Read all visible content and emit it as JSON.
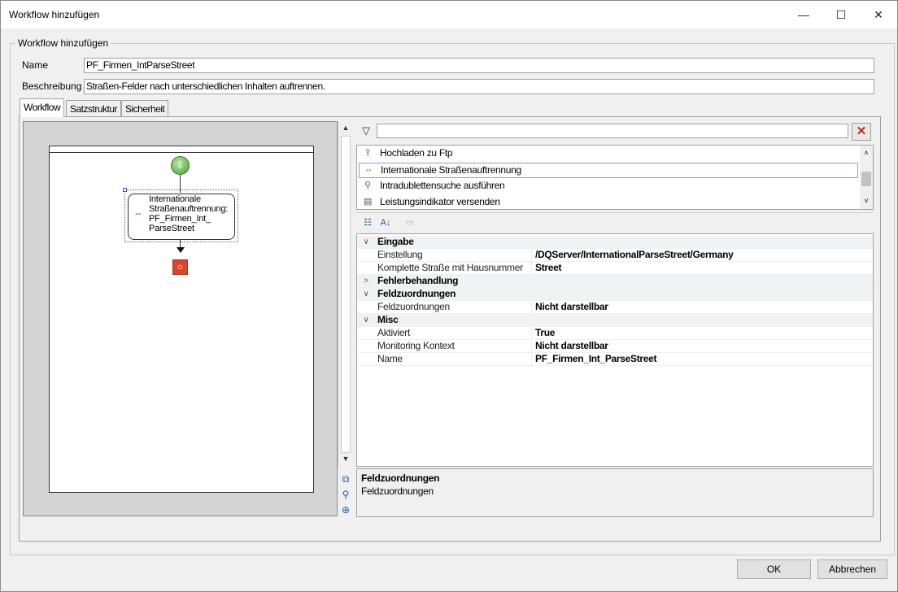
{
  "window": {
    "title": "Workflow hinzufügen",
    "controls": {
      "minimize": "—",
      "maximize": "☐",
      "close": "✕"
    }
  },
  "groupbox": {
    "title": "Workflow hinzufügen"
  },
  "form": {
    "name_label": "Name",
    "name_value": "PF_Firmen_IntParseStreet",
    "description_label": "Beschreibung",
    "description_value": "Straßen-Felder nach unterschiedlichen Inhalten auftrennen."
  },
  "tabs": [
    {
      "label": "Workflow",
      "active": true
    },
    {
      "label": "Satzstruktur",
      "active": false
    },
    {
      "label": "Sicherheit",
      "active": false
    }
  ],
  "designer": {
    "start_icon": "green-down-arrow-circle",
    "node": {
      "line1": "Internationale",
      "line2": "Straßenauftrennung:",
      "line3": "PF_Firmen_Int_",
      "line4": "ParseStreet"
    },
    "end_icon": "red-stop-square"
  },
  "side_tools": [
    "copy-icon",
    "find-icon",
    "zoom-icon"
  ],
  "activity_filter": {
    "value": ""
  },
  "activities": [
    {
      "label": "Hochladen zu Ftp",
      "icon": "upload-icon",
      "selected": false
    },
    {
      "label": "Internationale Straßenauftrennung",
      "icon": "split-arrows-icon",
      "selected": true
    },
    {
      "label": "Intradublettensuche ausführen",
      "icon": "magnifier-icon",
      "selected": false
    },
    {
      "label": "Leistungsindikator versenden",
      "icon": "indicator-icon",
      "selected": false
    }
  ],
  "propgrid": {
    "toolbar": [
      "categorized-icon",
      "alphabetical-icon",
      "property-pages-icon"
    ],
    "rows": [
      {
        "kind": "cat",
        "expander": "∨",
        "name": "Eingabe"
      },
      {
        "kind": "prop",
        "name": "Einstellung",
        "value": "/DQServer/InternationalParseStreet/Germany"
      },
      {
        "kind": "prop",
        "name": "Komplette Straße mit Hausnummer",
        "value": "Street"
      },
      {
        "kind": "cat",
        "expander": ">",
        "name": "Fehlerbehandlung"
      },
      {
        "kind": "cat",
        "expander": "∨",
        "name": "Feldzuordnungen"
      },
      {
        "kind": "prop",
        "name": "Feldzuordnungen",
        "value": "Nicht darstellbar"
      },
      {
        "kind": "cat",
        "expander": "∨",
        "name": "Misc"
      },
      {
        "kind": "prop",
        "name": "Aktiviert",
        "value": "True"
      },
      {
        "kind": "prop",
        "name": "Monitoring Kontext",
        "value": "Nicht darstellbar"
      },
      {
        "kind": "prop",
        "name": "Name",
        "value": "PF_Firmen_Int_ParseStreet"
      }
    ]
  },
  "help": {
    "title": "Feldzuordnungen",
    "description": "Feldzuordnungen"
  },
  "buttons": {
    "ok": "OK",
    "cancel": "Abbrechen"
  }
}
